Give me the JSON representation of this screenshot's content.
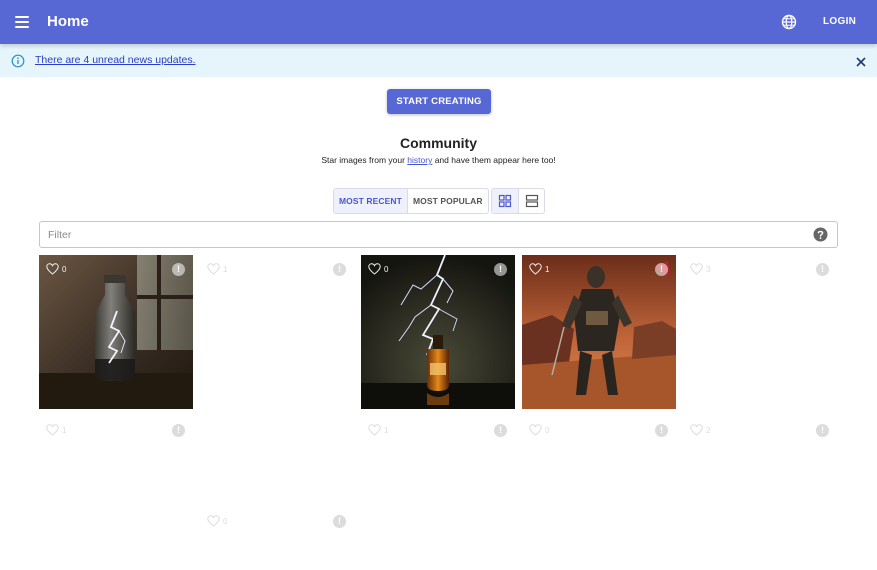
{
  "header": {
    "title": "Home",
    "login_label": "LOGIN",
    "menu_icon": "menu-icon",
    "globe_icon": "globe-icon"
  },
  "banner": {
    "text": "There are 4 unread news updates.",
    "icon": "info-icon",
    "close_icon": "close-icon",
    "bg": "#e6f5fb"
  },
  "cta": {
    "label": "START CREATING"
  },
  "community": {
    "title": "Community",
    "subtitle_before": "Star images from your ",
    "subtitle_link": "history",
    "subtitle_after": " and have them appear here too!"
  },
  "sort": {
    "most_recent": "MOST RECENT",
    "most_popular": "MOST POPULAR",
    "active": "MOST RECENT"
  },
  "view": {
    "active": "grid",
    "icons": [
      "grid-view-icon",
      "list-view-icon"
    ]
  },
  "filter": {
    "placeholder": "Filter",
    "value": ""
  },
  "tiles": [
    {
      "likes": "0",
      "image": "bottle-with-lightning"
    },
    {
      "likes": "1",
      "image": ""
    },
    {
      "likes": "0",
      "image": "lightning-over-bottle"
    },
    {
      "likes": "1",
      "image": "armored-warrior-desert"
    },
    {
      "likes": "3",
      "image": ""
    },
    {
      "likes": "1",
      "image": ""
    },
    {
      "likes": "1",
      "image": ""
    },
    {
      "likes": "0",
      "image": ""
    },
    {
      "likes": "2",
      "image": ""
    },
    {
      "likes": "0",
      "image": ""
    }
  ],
  "colors": {
    "primary": "#5768d4",
    "link": "#2b3ec9",
    "accent_bg": "#eef0fb"
  }
}
